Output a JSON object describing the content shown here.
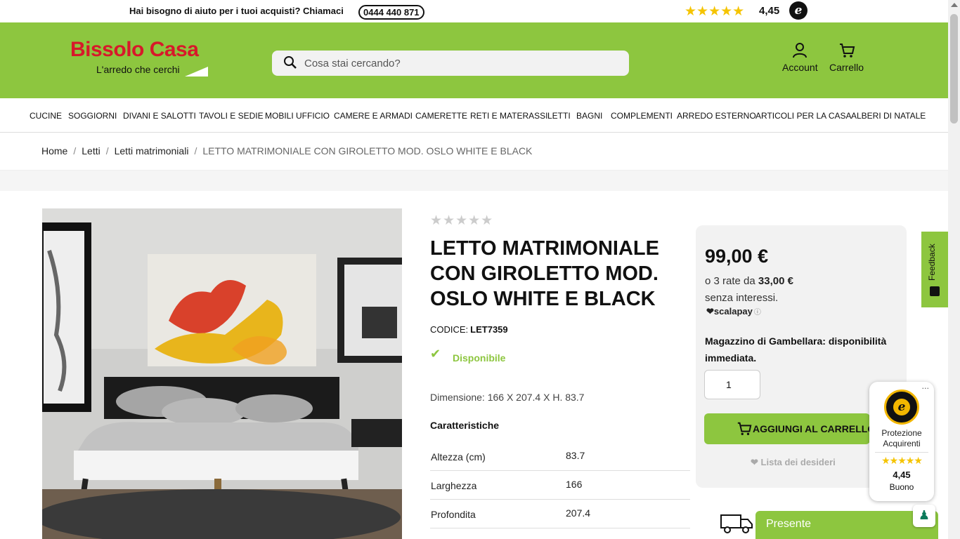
{
  "topbar": {
    "help_text": "Hai bisogno di aiuto per i tuoi acquisti? Chiamaci",
    "phone": "0444 440 871",
    "stars": "★★★★★",
    "rating": "4,45",
    "badge_letter": "e"
  },
  "header": {
    "logo_main": "Bissolo Casa",
    "logo_sub": "L'arredo che cerchi",
    "search_placeholder": "Cosa stai cercando?",
    "account_label": "Account",
    "cart_label": "Carrello"
  },
  "nav": {
    "items": [
      {
        "label": "CUCINE"
      },
      {
        "label": "SOGGIORNI"
      },
      {
        "label": "DIVANI E SALOTTI"
      },
      {
        "label": "TAVOLI E SEDIE"
      },
      {
        "label": "MOBILI UFFICIO"
      },
      {
        "label": "CAMERE E ARMADI"
      },
      {
        "label": "CAMERETTE"
      },
      {
        "label": "RETI E MATERASSI"
      },
      {
        "label": "LETTI"
      },
      {
        "label": "BAGNI"
      },
      {
        "label": "COMPLEMENTI"
      },
      {
        "label": "ARREDO ESTERNO"
      },
      {
        "label": "ARTICOLI PER LA CASA"
      },
      {
        "label": "ALBERI DI NATALE"
      }
    ]
  },
  "breadcrumb": {
    "separator": "/",
    "items": [
      "Home",
      "Letti",
      "Letti matrimoniali"
    ],
    "current": "LETTO MATRIMONIALE CON GIROLETTO MOD. OSLO WHITE E BLACK"
  },
  "product": {
    "stars": "★★★★★",
    "title": "LETTO MATRIMONIALE CON GIROLETTO MOD. OSLO WHITE E BLACK",
    "code_label": "CODICE:",
    "code": "LET7359",
    "availability": "Disponibile",
    "dimension": "Dimensione: 166 X 207.4 X H. 83.7",
    "features_title": "Caratteristiche",
    "specs": [
      {
        "key": "Altezza (cm)",
        "value": "83.7"
      },
      {
        "key": "Larghezza",
        "value": "166"
      },
      {
        "key": "Profondita",
        "value": "207.4"
      }
    ]
  },
  "purchase": {
    "price": "99,00 €",
    "installments_prefix": "o 3 rate da",
    "installment_amount": "33,00 €",
    "installments_suffix": "senza interessi.",
    "scalapay": "scalapay",
    "stock_text": "Magazzino di Gambellara: disponibilità immediata.",
    "quantity": "1",
    "add_to_cart": "AGGIUNGI AL CARRELLO",
    "wishlist": "Lista dei desideri"
  },
  "feedback": {
    "label": "Feedback"
  },
  "trusted_shops": {
    "label": "Protezione Acquirenti",
    "stars": "★★★★★",
    "score": "4,45",
    "word": "Buono",
    "menu": "..."
  },
  "chat": {
    "label": "Presente"
  },
  "colors": {
    "brand_green": "#8dc63f",
    "brand_red": "#d7192a",
    "star": "#f5c400"
  }
}
